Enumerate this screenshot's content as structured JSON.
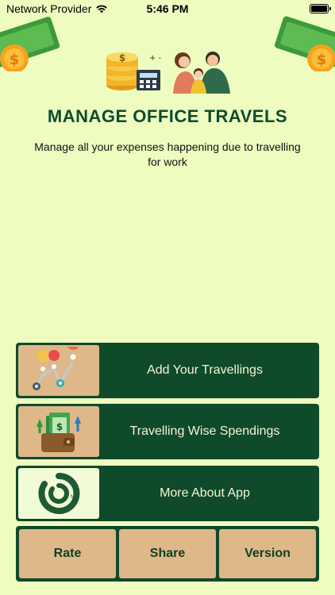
{
  "status_bar": {
    "carrier": "Network Provider",
    "time": "5:46 PM"
  },
  "header": {
    "title": "MANAGE OFFICE TRAVELS",
    "subtitle": "Manage all your expenses happening due to travelling for work"
  },
  "menu": [
    {
      "label": "Add Your Travellings",
      "icon": "map-route-icon"
    },
    {
      "label": "Travelling Wise Spendings",
      "icon": "wallet-money-icon"
    },
    {
      "label": "More About App",
      "icon": "app-logo-icon"
    }
  ],
  "bottom_bar": {
    "rate_label": "Rate",
    "share_label": "Share",
    "version_label": "Version"
  },
  "colors": {
    "background": "#eefcc0",
    "accent_dark_green": "#0f4a2a",
    "tan": "#deb889"
  }
}
